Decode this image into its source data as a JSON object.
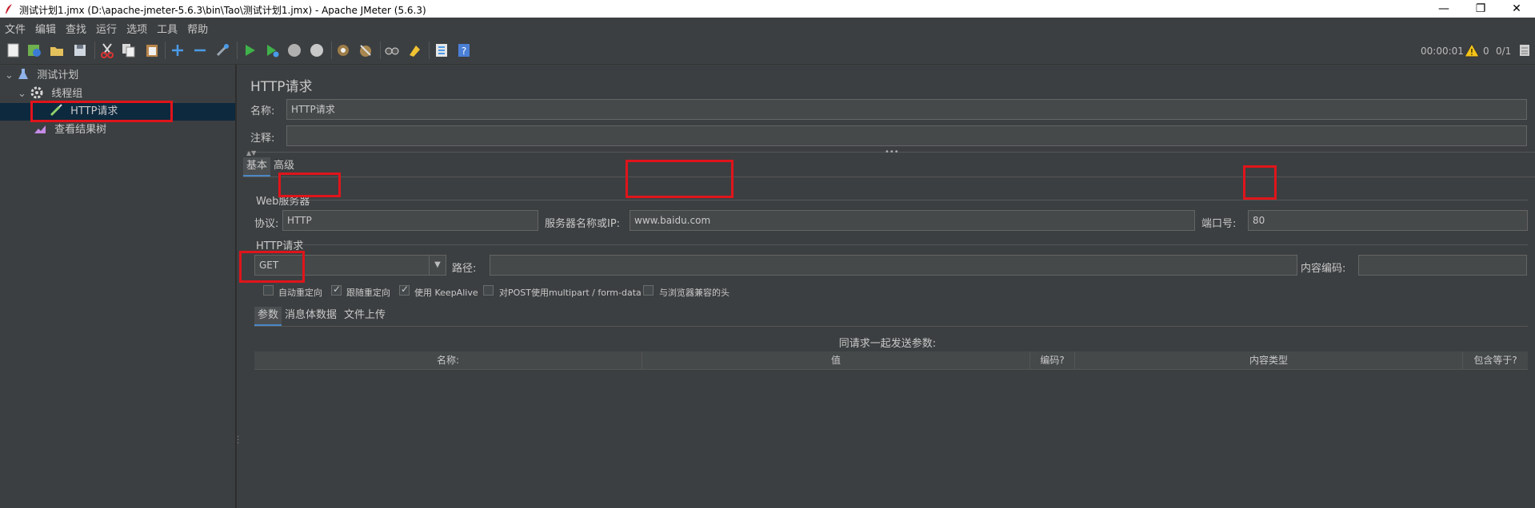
{
  "window": {
    "title": "测试计划1.jmx (D:\\apache-jmeter-5.6.3\\bin\\Tao\\测试计划1.jmx) - Apache JMeter (5.6.3)",
    "controls": [
      "—",
      "❐",
      "✕"
    ]
  },
  "menu": [
    "文件",
    "编辑",
    "查找",
    "运行",
    "选项",
    "工具",
    "帮助"
  ],
  "toolbar": {
    "icons": [
      "new-icon",
      "templates-icon",
      "open-icon",
      "save-icon",
      "cut-icon",
      "copy-icon",
      "paste-icon",
      "expand-icon",
      "collapse-icon",
      "toggle-icon",
      "start-icon",
      "start-no-pause-icon",
      "stop-icon",
      "shutdown-icon",
      "clear-icon",
      "clear-all-icon",
      "search-icon",
      "reset-search-icon",
      "function-helper-icon",
      "help-icon"
    ],
    "timer": "00:00:01",
    "warnings": "0",
    "threads": "0/1"
  },
  "tree": {
    "items": [
      {
        "label": "测试计划",
        "icon": "test-plan-icon",
        "level": 0
      },
      {
        "label": "线程组",
        "icon": "thread-group-icon",
        "level": 1
      },
      {
        "label": "HTTP请求",
        "icon": "http-sampler-icon",
        "level": 2
      },
      {
        "label": "查看结果树",
        "icon": "results-tree-icon",
        "level": 1
      }
    ]
  },
  "panel": {
    "title": "HTTP请求",
    "name_label": "名称:",
    "name_value": "HTTP请求",
    "comment_label": "注释:",
    "comment_value": "",
    "tabs": [
      "基本",
      "高级"
    ],
    "web_server_legend": "Web服务器",
    "protocol_label": "协议:",
    "protocol_value": "HTTP",
    "server_label": "服务器名称或IP:",
    "server_value": "www.baidu.com",
    "port_label": "端口号:",
    "port_value": "80",
    "http_request_legend": "HTTP请求",
    "method_value": "GET",
    "path_label": "路径:",
    "path_value": "",
    "encoding_label": "内容编码:",
    "encoding_value": "",
    "checkboxes": [
      {
        "label": "自动重定向",
        "checked": false
      },
      {
        "label": "跟随重定向",
        "checked": true
      },
      {
        "label": "使用 KeepAlive",
        "checked": true
      },
      {
        "label": "对POST使用multipart / form-data",
        "checked": false
      },
      {
        "label": "与浏览器兼容的头",
        "checked": false
      }
    ],
    "subtabs": [
      "参数",
      "消息体数据",
      "文件上传"
    ],
    "params_caption": "同请求一起发送参数:",
    "columns": [
      "名称:",
      "值",
      "编码?",
      "内容类型",
      "包含等于?"
    ]
  },
  "colors": {
    "background": "#3c3f41",
    "field": "#45494a",
    "selection": "#0d293e",
    "highlight_box": "#e0141b"
  }
}
